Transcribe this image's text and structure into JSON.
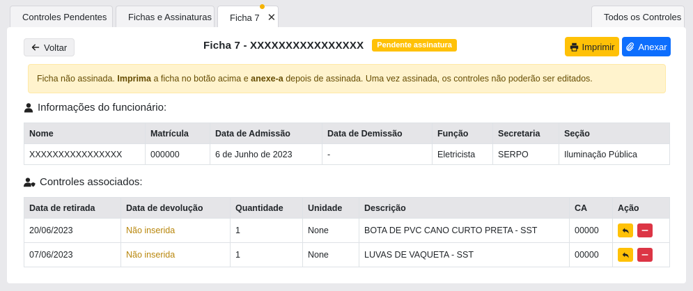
{
  "tabs": [
    {
      "label": "Controles Pendentes",
      "icon": "warning-icon"
    },
    {
      "label": "Fichas e Assinaturas",
      "icon": "folder-open-icon"
    },
    {
      "label": "Ficha 7",
      "icon": "paperclip-icon"
    },
    {
      "label": "Todos os Controles",
      "icon": "gear-icon"
    }
  ],
  "header": {
    "back_label": "Voltar",
    "title": "Ficha 7 - XXXXXXXXXXXXXXXX",
    "badge": "Pendente assinatura",
    "print_label": "Imprimir",
    "attach_label": "Anexar"
  },
  "alert": {
    "part1": "Ficha não assinada. ",
    "bold1": "Imprima",
    "part2": " a ficha no botão acima e ",
    "bold2": "anexe-a",
    "part3": " depois de assinada. Uma vez assinada, os controles não poderão ser editados."
  },
  "employee": {
    "section_title": "Informações do funcionário:",
    "headers": [
      "Nome",
      "Matrícula",
      "Data de Admissão",
      "Data de Demissão",
      "Função",
      "Secretaria",
      "Seção"
    ],
    "row": [
      "XXXXXXXXXXXXXXXX",
      "000000",
      "6 de Junho de 2023",
      "-",
      "Eletricista",
      "SERPO",
      "Iluminação Pública"
    ]
  },
  "controls": {
    "section_title": "Controles associados:",
    "headers": [
      "Data de retirada",
      "Data de devolução",
      "Quantidade",
      "Unidade",
      "Descrição",
      "CA",
      "Ação"
    ],
    "rows": [
      [
        "20/06/2023",
        "Não inserida",
        "1",
        "None",
        "BOTA DE PVC CANO CURTO PRETA - SST",
        "00000"
      ],
      [
        "07/06/2023",
        "Não inserida",
        "1",
        "None",
        "LUVAS DE VAQUETA - SST",
        "00000"
      ]
    ]
  },
  "colors": {
    "warning": "#ffc107",
    "primary": "#0d6efd",
    "danger": "#dc3545",
    "alert_bg": "#fff3cd"
  }
}
